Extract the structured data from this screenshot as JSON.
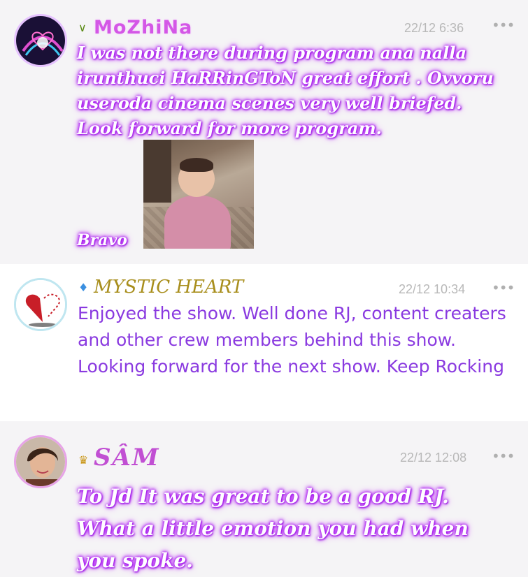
{
  "comments": [
    {
      "username": "MoZhiNa",
      "badge_icon": "leaf-badge-icon",
      "badge_glyph": "∨",
      "time": "22/12 6:36",
      "more": "•••",
      "text": "I was not there during program ana nalla irunthuci HaRRinGToN great effort . Ovvoru useroda cinema scenes very well briefed. Look forward for more program.",
      "footer_text": "Bravo"
    },
    {
      "username": "MYSTIC HEART",
      "badge_icon": "diamond-icon",
      "badge_glyph": "♦",
      "time": "22/12 10:34",
      "more": "•••",
      "text": "Enjoyed the show. Well done RJ, content creaters and other crew members behind this show. Looking forward for the next show. Keep Rocking"
    },
    {
      "username": "SÂM",
      "badge_icon": "crown-icon",
      "badge_glyph": "♛",
      "time": "22/12 12:08",
      "more": "•••",
      "text": "To Jd It was great to be a good RJ. What a little emotion you had when you spoke."
    }
  ]
}
